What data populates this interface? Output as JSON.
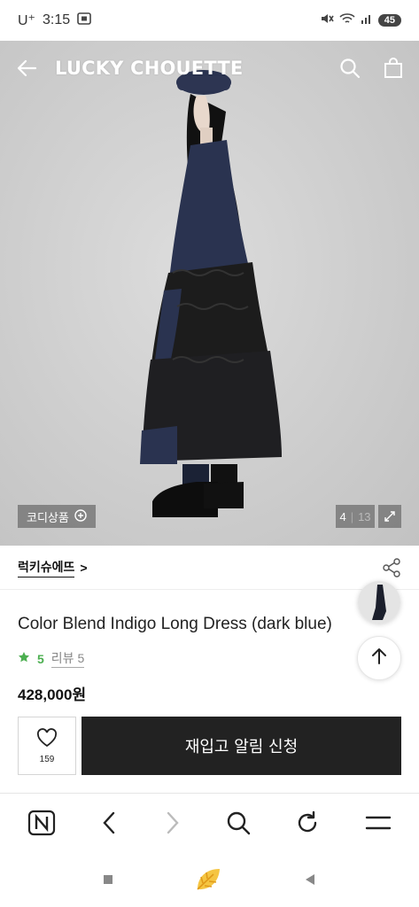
{
  "status_bar": {
    "carrier": "U⁺",
    "time": "3:15",
    "battery": "45"
  },
  "header": {
    "brand": "LUCKY CHOUETTE"
  },
  "hero": {
    "codi_label": "코디상품",
    "image_index": "4",
    "image_total": "13",
    "separator": "|"
  },
  "brand_row": {
    "brand_name": "럭키슈에뜨",
    "chevron": ">"
  },
  "product": {
    "title": "Color Blend Indigo Long Dress (dark blue)",
    "rating": "5",
    "review_label": "리뷰 5",
    "price": "428,000원"
  },
  "actions": {
    "like_count": "159",
    "restock_label": "재입고 알림 신청"
  },
  "colors": {
    "accent_green": "#4caf50",
    "cta_dark": "#222222",
    "dress_navy": "#2a3350"
  },
  "icons": [
    "back-arrow-icon",
    "search-icon",
    "shopping-bag-icon",
    "plus-circle-icon",
    "expand-icon",
    "share-icon",
    "arrow-up-icon",
    "heart-icon",
    "naver-n-icon",
    "chevron-left-icon",
    "chevron-right-icon",
    "refresh-icon",
    "menu-icon",
    "square-icon",
    "leaf-icon",
    "triangle-back-icon"
  ]
}
